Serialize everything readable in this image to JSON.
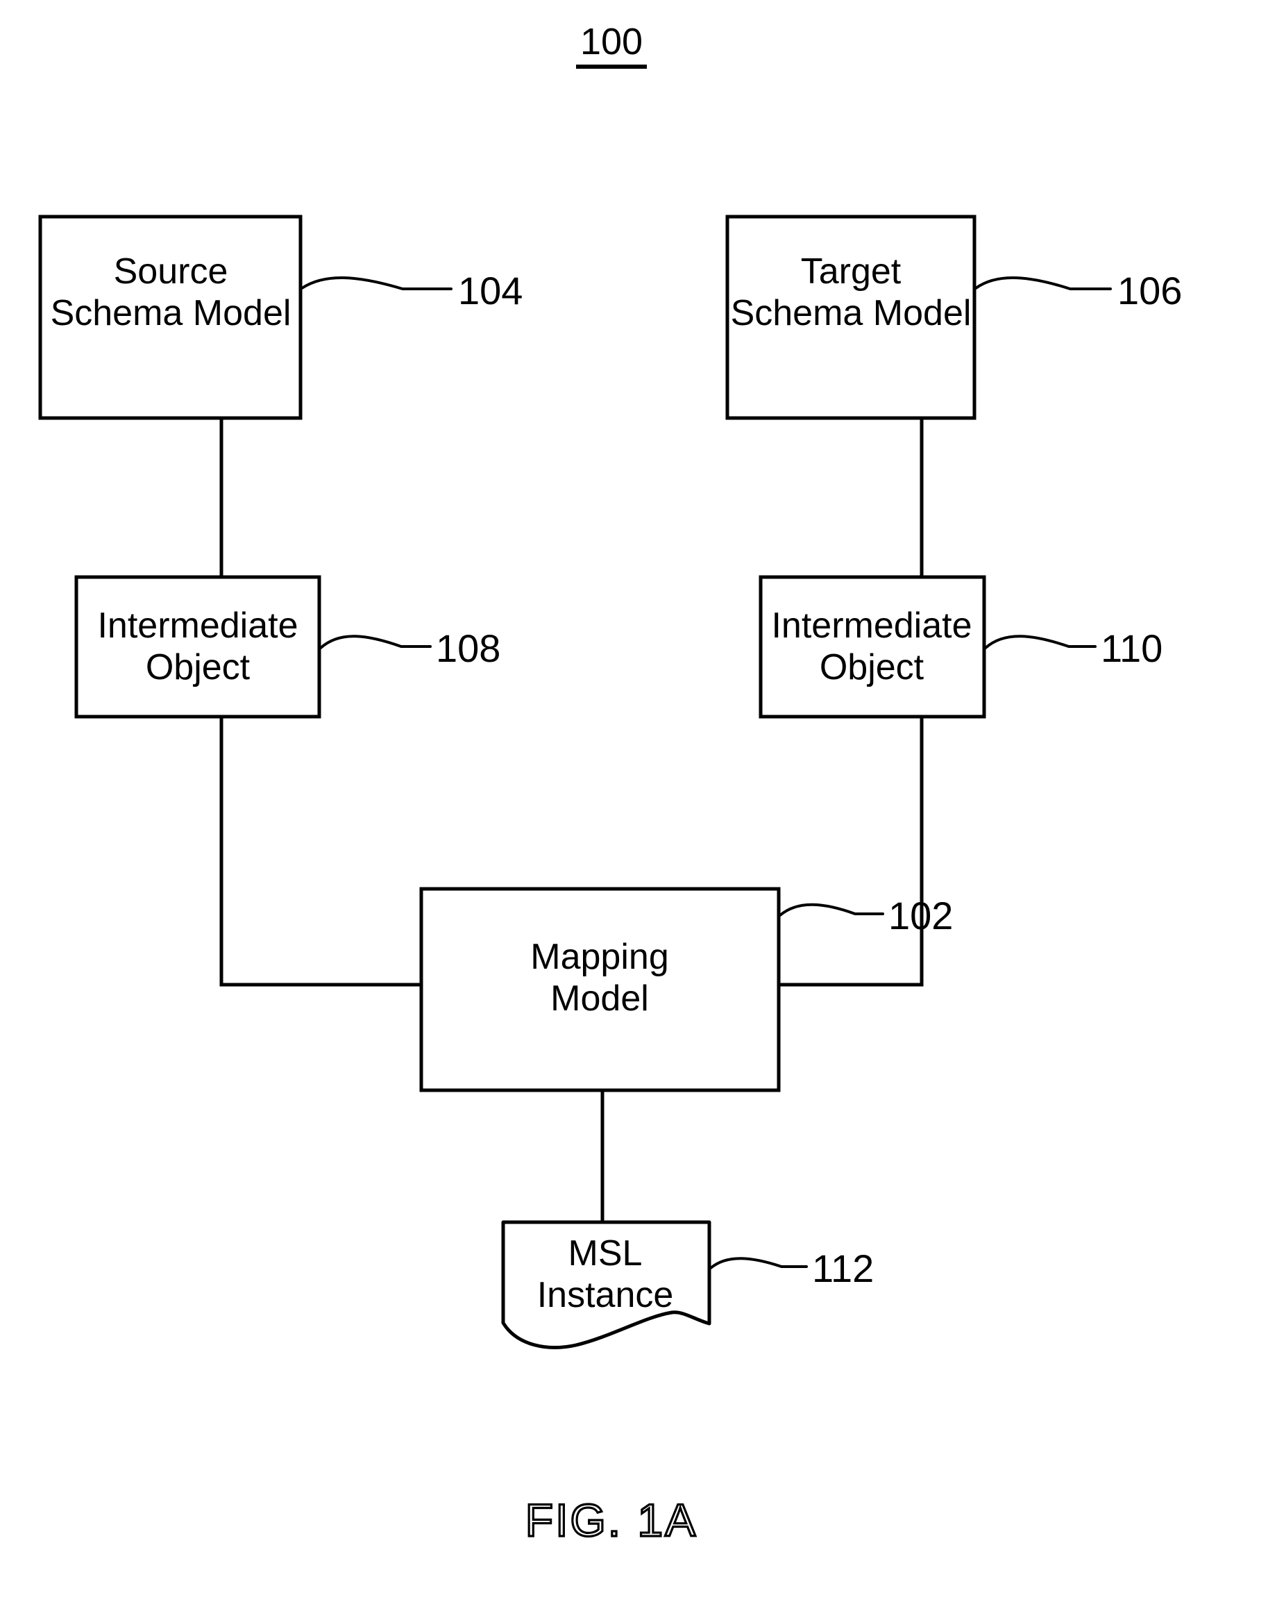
{
  "figure": {
    "figure_number_top": "100",
    "caption": "FIG. 1A",
    "line_color": "#000000",
    "background_color": "#ffffff"
  },
  "nodes": {
    "source_schema_model": {
      "ref": "104",
      "line1": "Source",
      "line2": "Schema Model"
    },
    "target_schema_model": {
      "ref": "106",
      "line1": "Target",
      "line2": "Schema Model"
    },
    "intermediate_object_left": {
      "ref": "108",
      "line1": "Intermediate",
      "line2": "Object"
    },
    "intermediate_object_right": {
      "ref": "110",
      "line1": "Intermediate",
      "line2": "Object"
    },
    "mapping_model": {
      "ref": "102",
      "line1": "Mapping",
      "line2": "Model"
    },
    "msl_instance": {
      "ref": "112",
      "line1": "MSL",
      "line2": "Instance"
    }
  }
}
